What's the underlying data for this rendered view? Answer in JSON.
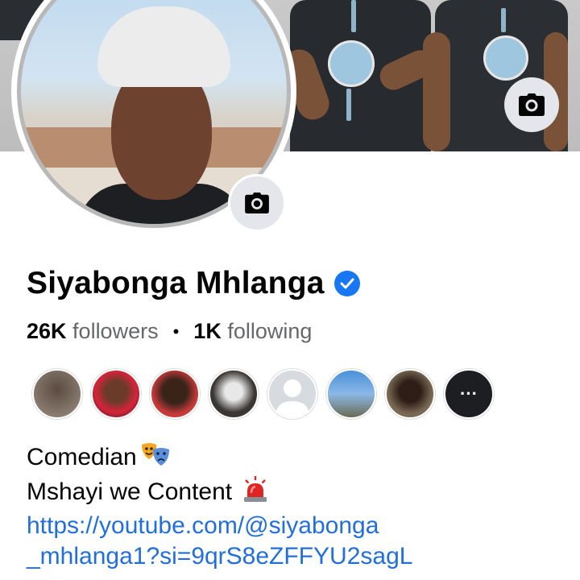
{
  "profile": {
    "name": "Siyabonga Mhlanga",
    "verified": true
  },
  "stats": {
    "followers_count": "26K",
    "followers_label": "followers",
    "following_count": "1K",
    "following_label": "following",
    "separator": "•"
  },
  "mutual_friends": {
    "more_label": "···"
  },
  "bio": {
    "line1": "Comedian",
    "line1_emoji": "performing-arts-masks",
    "line2": "Mshayi we Content ",
    "line2_emoji": "police-car-light",
    "link_line1": "https://youtube.com/@siyabonga",
    "link_line2": "_mhlanga1?si=9qrS8eZFFYU2sagL"
  },
  "icons": {
    "cover_camera": "camera-icon",
    "avatar_camera": "camera-icon",
    "verified": "verified-badge-icon"
  },
  "colors": {
    "link": "#216fdb",
    "verified": "#1877f2",
    "secondary_text": "#65676b"
  }
}
